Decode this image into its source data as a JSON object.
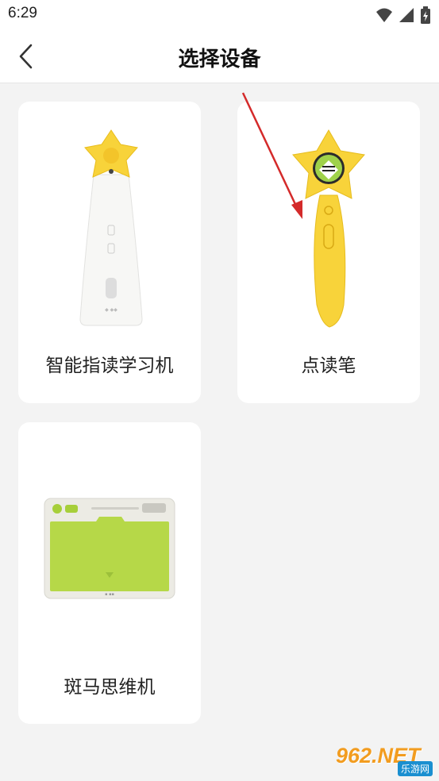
{
  "status_bar": {
    "time": "6:29"
  },
  "header": {
    "title": "选择设备"
  },
  "devices": [
    {
      "label": "智能指读学习机",
      "image": "white-star-learning-machine"
    },
    {
      "label": "点读笔",
      "image": "yellow-star-reading-pen"
    },
    {
      "label": "斑马思维机",
      "image": "green-thinking-machine"
    }
  ],
  "watermark": {
    "brand": "962.NET",
    "sub": "乐游网"
  },
  "colors": {
    "accent_yellow": "#f8d33a",
    "tablet_green": "#b6d848",
    "arrow_red": "#d42a2a"
  }
}
